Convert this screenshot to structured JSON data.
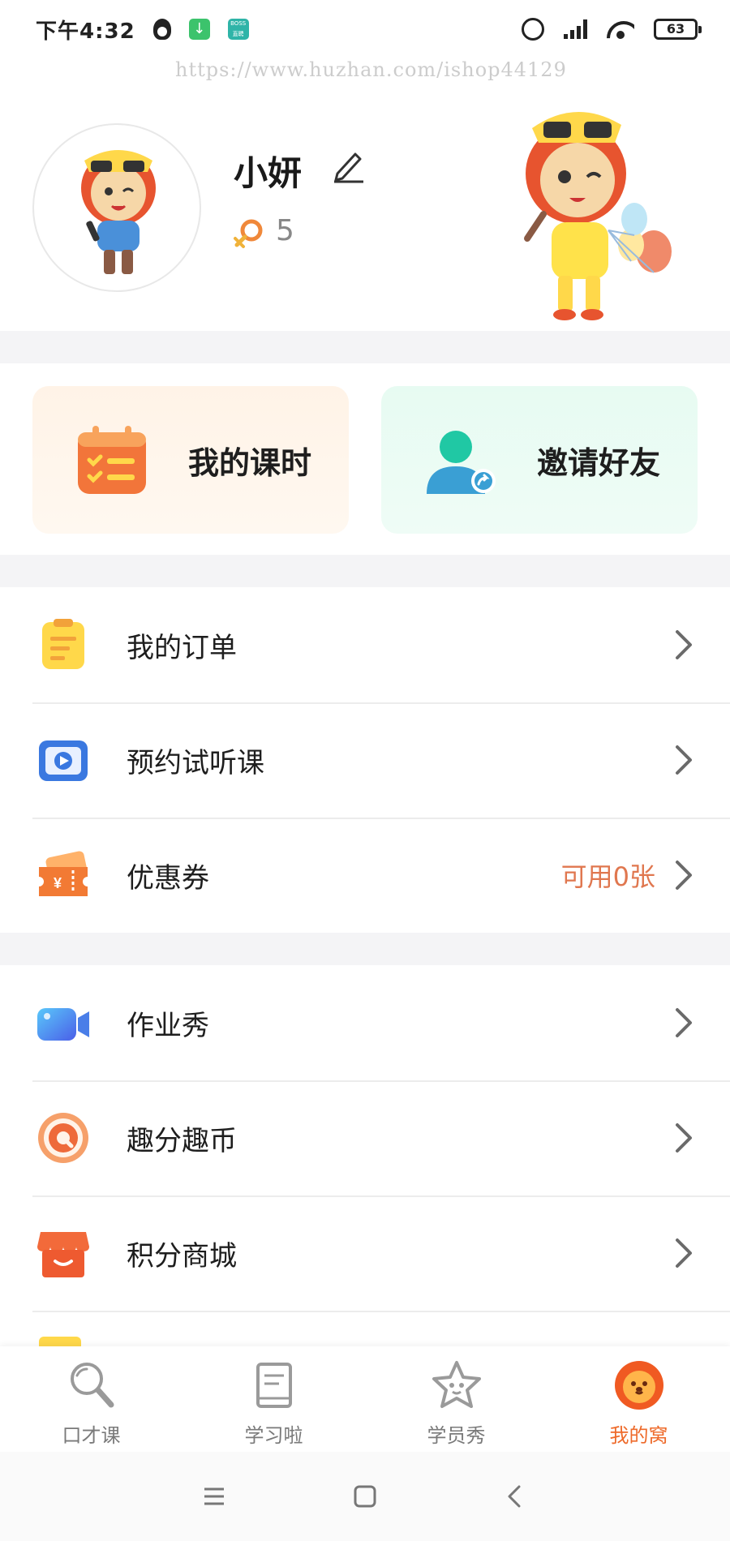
{
  "status_bar": {
    "time": "下午4:32",
    "boss_badge": "BOSS\n直聘",
    "battery": "63"
  },
  "watermark": "https://www.huzhan.com/ishop44129",
  "profile": {
    "name": "小妍",
    "level": "5"
  },
  "quick_actions": [
    {
      "label": "我的课时",
      "icon": "calendar-icon"
    },
    {
      "label": "邀请好友",
      "icon": "invite-friend-icon"
    }
  ],
  "menu_group_1": [
    {
      "label": "我的订单",
      "icon": "clipboard-icon",
      "extra": ""
    },
    {
      "label": "预约试听课",
      "icon": "video-play-icon",
      "extra": ""
    },
    {
      "label": "优惠券",
      "icon": "coupon-icon",
      "extra": "可用0张"
    }
  ],
  "menu_group_2": [
    {
      "label": "作业秀",
      "icon": "camera-icon",
      "extra": ""
    },
    {
      "label": "趣分趣币",
      "icon": "coin-icon",
      "extra": ""
    },
    {
      "label": "积分商城",
      "icon": "shop-icon",
      "extra": ""
    }
  ],
  "tabbar": {
    "active": 3,
    "tabs": [
      {
        "label": "口才课",
        "icon": "magnifier-mic-icon"
      },
      {
        "label": "学习啦",
        "icon": "book-icon"
      },
      {
        "label": "学员秀",
        "icon": "star-face-icon"
      },
      {
        "label": "我的窝",
        "icon": "lion-face-icon"
      }
    ]
  },
  "colors": {
    "accent": "#ee6a2a",
    "coupon_extra": "#e0774f",
    "invite_card_bg": "#e7fbf2",
    "hours_card_bg": "#fff3e7"
  }
}
